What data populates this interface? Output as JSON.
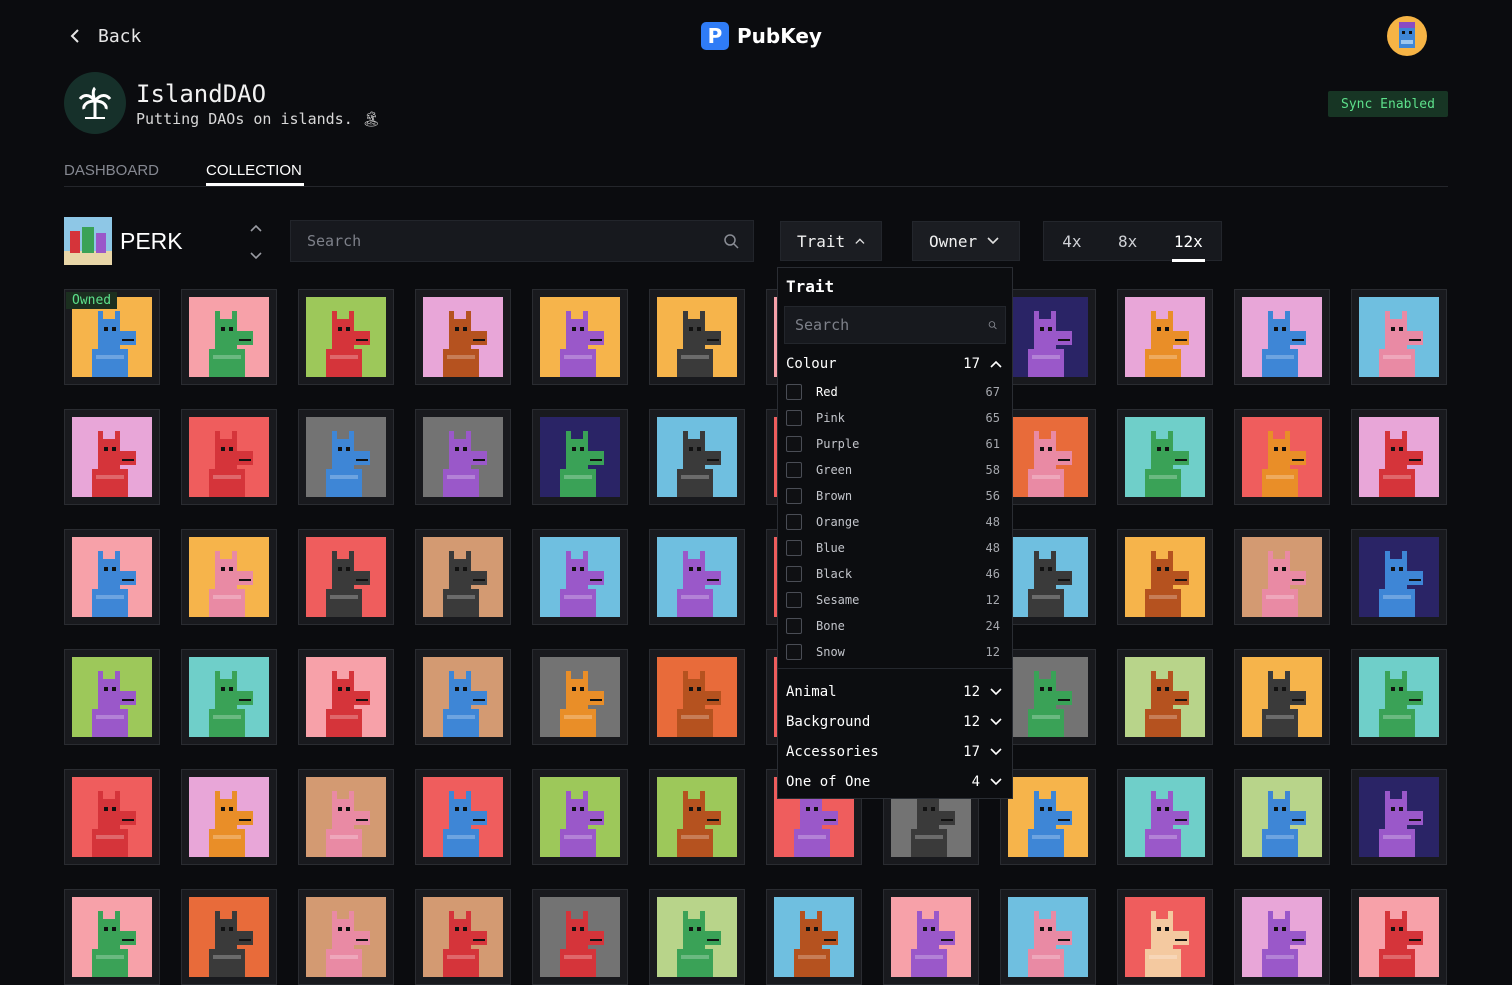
{
  "header": {
    "back_label": "Back",
    "brand_letter": "P",
    "brand_name": "PubKey"
  },
  "dao": {
    "name": "IslandDAO",
    "description": "Putting DAOs on islands. 🏝",
    "sync_status": "Sync Enabled"
  },
  "tabs": [
    {
      "label": "DASHBOARD",
      "active": false
    },
    {
      "label": "COLLECTION",
      "active": true
    }
  ],
  "collection": {
    "name": "PERK",
    "search_placeholder": "Search",
    "trait_button": "Trait",
    "owner_button": "Owner",
    "sizes": [
      "4x",
      "8x",
      "12x"
    ],
    "active_size": "12x",
    "owned_badge": "Owned"
  },
  "trait_panel": {
    "title": "Trait",
    "search_placeholder": "Search",
    "groups": [
      {
        "label": "Colour",
        "count": "17",
        "expanded": true,
        "options": [
          {
            "label": "Red",
            "count": "67"
          },
          {
            "label": "Pink",
            "count": "65"
          },
          {
            "label": "Purple",
            "count": "61"
          },
          {
            "label": "Green",
            "count": "58"
          },
          {
            "label": "Brown",
            "count": "56"
          },
          {
            "label": "Orange",
            "count": "48"
          },
          {
            "label": "Blue",
            "count": "48"
          },
          {
            "label": "Black",
            "count": "46"
          },
          {
            "label": "Sesame",
            "count": "12"
          },
          {
            "label": "Bone",
            "count": "24"
          },
          {
            "label": "Snow",
            "count": "12"
          }
        ]
      },
      {
        "label": "Animal",
        "count": "12",
        "expanded": false
      },
      {
        "label": "Background",
        "count": "12",
        "expanded": false
      },
      {
        "label": "Accessories",
        "count": "17",
        "expanded": false
      },
      {
        "label": "One of One",
        "count": "4",
        "expanded": false
      }
    ]
  },
  "colors": {
    "accent_green": "#5de08b",
    "brand_blue": "#2f7cf6",
    "background": "#0b0c0f"
  },
  "grid": {
    "rows": [
      [
        {
          "bg": "#f6b44b",
          "body": "#3e86d6"
        },
        {
          "bg": "#f7a1a9",
          "body": "#3aa257"
        },
        {
          "bg": "#9dc85a",
          "body": "#d5343a"
        },
        {
          "bg": "#e8a6d8",
          "body": "#b5521f"
        },
        {
          "bg": "#f6b44b",
          "body": "#9a58c9"
        },
        {
          "bg": "#f6b44b",
          "body": "#3a3a3a"
        },
        {
          "bg": "#f7a1a9",
          "body": "#d5343a"
        },
        {
          "bg": "#f6b44b",
          "body": "#3aa257"
        },
        {
          "bg": "#2a2466",
          "body": "#9a58c9"
        },
        {
          "bg": "#e8a6d8",
          "body": "#e98e28"
        },
        {
          "bg": "#e8a6d8",
          "body": "#3e86d6"
        },
        {
          "bg": "#6fbfe0",
          "body": "#e98aa4"
        }
      ],
      [
        {
          "bg": "#e8a6d8",
          "body": "#d5343a"
        },
        {
          "bg": "#ef5d5d",
          "body": "#d5343a"
        },
        {
          "bg": "#737373",
          "body": "#3e86d6"
        },
        {
          "bg": "#737373",
          "body": "#9a58c9"
        },
        {
          "bg": "#2a2466",
          "body": "#3aa257"
        },
        {
          "bg": "#6fbfe0",
          "body": "#3a3a3a"
        },
        {
          "bg": "#ef5d5d",
          "body": "#e98aa4"
        },
        {
          "bg": "#ef5d5d",
          "body": "#e98aa4"
        },
        {
          "bg": "#e86b3a",
          "body": "#e98aa4"
        },
        {
          "bg": "#6fcfc9",
          "body": "#3aa257"
        },
        {
          "bg": "#ef5d5d",
          "body": "#e98e28"
        },
        {
          "bg": "#e8a6d8",
          "body": "#d5343a"
        }
      ],
      [
        {
          "bg": "#f7a1a9",
          "body": "#3e86d6"
        },
        {
          "bg": "#f6b44b",
          "body": "#e98aa4"
        },
        {
          "bg": "#ef5d5d",
          "body": "#3a3a3a"
        },
        {
          "bg": "#d39a72",
          "body": "#3a3a3a"
        },
        {
          "bg": "#6fbfe0",
          "body": "#9a58c9"
        },
        {
          "bg": "#6fbfe0",
          "body": "#9a58c9"
        },
        {
          "bg": "#ef5d5d",
          "body": "#3a3a3a"
        },
        {
          "bg": "#ef5d5d",
          "body": "#3a3a3a"
        },
        {
          "bg": "#6fbfe0",
          "body": "#3a3a3a"
        },
        {
          "bg": "#f6b44b",
          "body": "#b5521f"
        },
        {
          "bg": "#d39a72",
          "body": "#e98aa4"
        },
        {
          "bg": "#2a2466",
          "body": "#3e86d6"
        }
      ],
      [
        {
          "bg": "#9dc85a",
          "body": "#9a58c9"
        },
        {
          "bg": "#6fcfc9",
          "body": "#3aa257"
        },
        {
          "bg": "#f7a1a9",
          "body": "#d5343a"
        },
        {
          "bg": "#d39a72",
          "body": "#3e86d6"
        },
        {
          "bg": "#737373",
          "body": "#e98e28"
        },
        {
          "bg": "#e86b3a",
          "body": "#b5521f"
        },
        {
          "bg": "#ef5d5d",
          "body": "#9a58c9"
        },
        {
          "bg": "#737373",
          "body": "#3aa257"
        },
        {
          "bg": "#737373",
          "body": "#3aa257"
        },
        {
          "bg": "#b8d48a",
          "body": "#b5521f"
        },
        {
          "bg": "#f6b44b",
          "body": "#3a3a3a"
        },
        {
          "bg": "#6fcfc9",
          "body": "#3aa257"
        }
      ],
      [
        {
          "bg": "#ef5d5d",
          "body": "#d5343a"
        },
        {
          "bg": "#e8a6d8",
          "body": "#e98e28"
        },
        {
          "bg": "#d39a72",
          "body": "#e98aa4"
        },
        {
          "bg": "#ef5d5d",
          "body": "#3e86d6"
        },
        {
          "bg": "#9dc85a",
          "body": "#9a58c9"
        },
        {
          "bg": "#9dc85a",
          "body": "#b5521f"
        },
        {
          "bg": "#ef5d5d",
          "body": "#9a58c9"
        },
        {
          "bg": "#737373",
          "body": "#3a3a3a"
        },
        {
          "bg": "#f6b44b",
          "body": "#3e86d6"
        },
        {
          "bg": "#6fcfc9",
          "body": "#9a58c9"
        },
        {
          "bg": "#b8d48a",
          "body": "#3e86d6"
        },
        {
          "bg": "#2a2466",
          "body": "#9a58c9"
        }
      ],
      [
        {
          "bg": "#f7a1a9",
          "body": "#3aa257"
        },
        {
          "bg": "#e86b3a",
          "body": "#3a3a3a"
        },
        {
          "bg": "#d39a72",
          "body": "#e98aa4"
        },
        {
          "bg": "#d39a72",
          "body": "#d5343a"
        },
        {
          "bg": "#737373",
          "body": "#d5343a"
        },
        {
          "bg": "#b8d48a",
          "body": "#3aa257"
        },
        {
          "bg": "#6fbfe0",
          "body": "#b5521f"
        },
        {
          "bg": "#f7a1a9",
          "body": "#9a58c9"
        },
        {
          "bg": "#6fbfe0",
          "body": "#e98aa4"
        },
        {
          "bg": "#ef5d5d",
          "body": "#f4c9a0"
        },
        {
          "bg": "#e8a6d8",
          "body": "#9a58c9"
        },
        {
          "bg": "#f7a1a9",
          "body": "#d5343a"
        }
      ]
    ]
  }
}
